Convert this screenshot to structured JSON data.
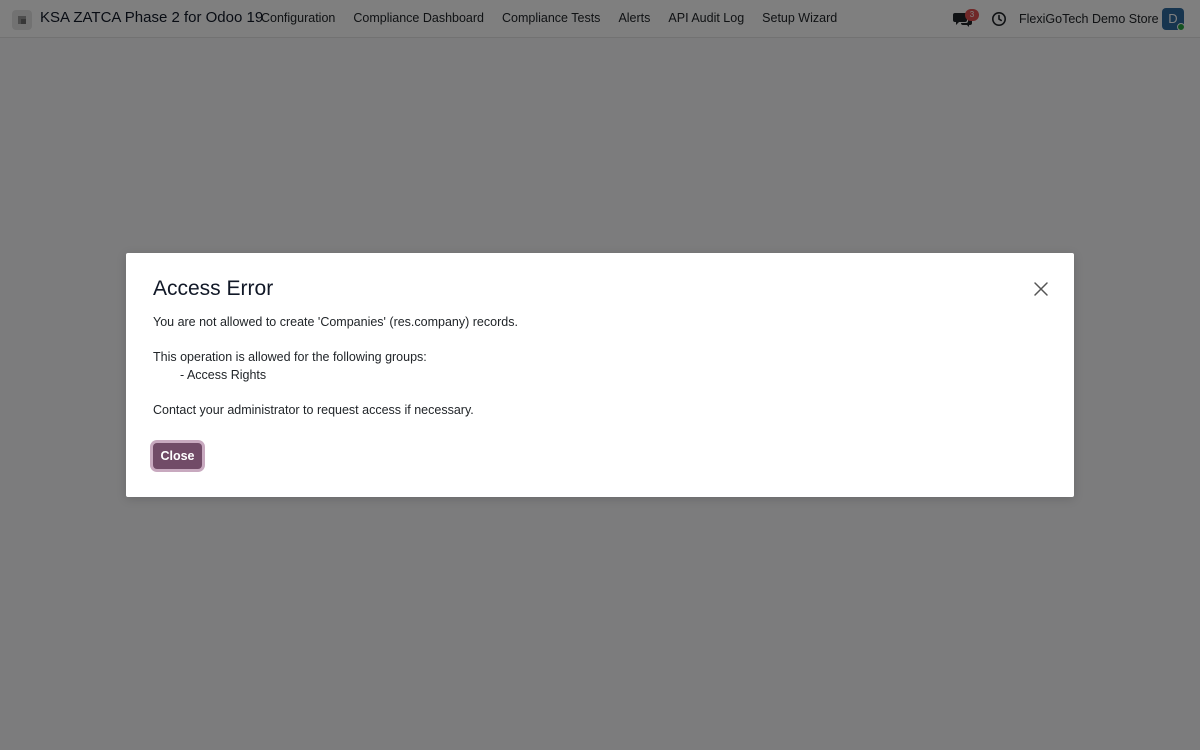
{
  "navbar": {
    "app_title": "KSA ZATCA Phase 2 for Odoo 19",
    "menu": [
      {
        "label": "Configuration"
      },
      {
        "label": "Compliance Dashboard"
      },
      {
        "label": "Compliance Tests"
      },
      {
        "label": "Alerts"
      },
      {
        "label": "API Audit Log"
      },
      {
        "label": "Setup Wizard"
      }
    ],
    "chat_badge_count": "3",
    "company_name": "FlexiGoTech Demo Store",
    "avatar_initial": "D",
    "colors": {
      "badge": "#e05050",
      "avatar": "#2e6a9e",
      "status_online": "#28a745"
    },
    "icons": [
      "app-icon",
      "chat-icon",
      "clock-icon"
    ]
  },
  "modal": {
    "title": "Access Error",
    "message_line1": "You are not allowed to create 'Companies' (res.company) records.",
    "message_line2": "This operation is allowed for the following groups:",
    "message_line3": "- Access Rights",
    "message_line4": "Contact your administrator to request access if necessary.",
    "close_button_label": "Close",
    "close_icon": "close-icon",
    "colors": {
      "primary_button": "#714b67"
    }
  }
}
